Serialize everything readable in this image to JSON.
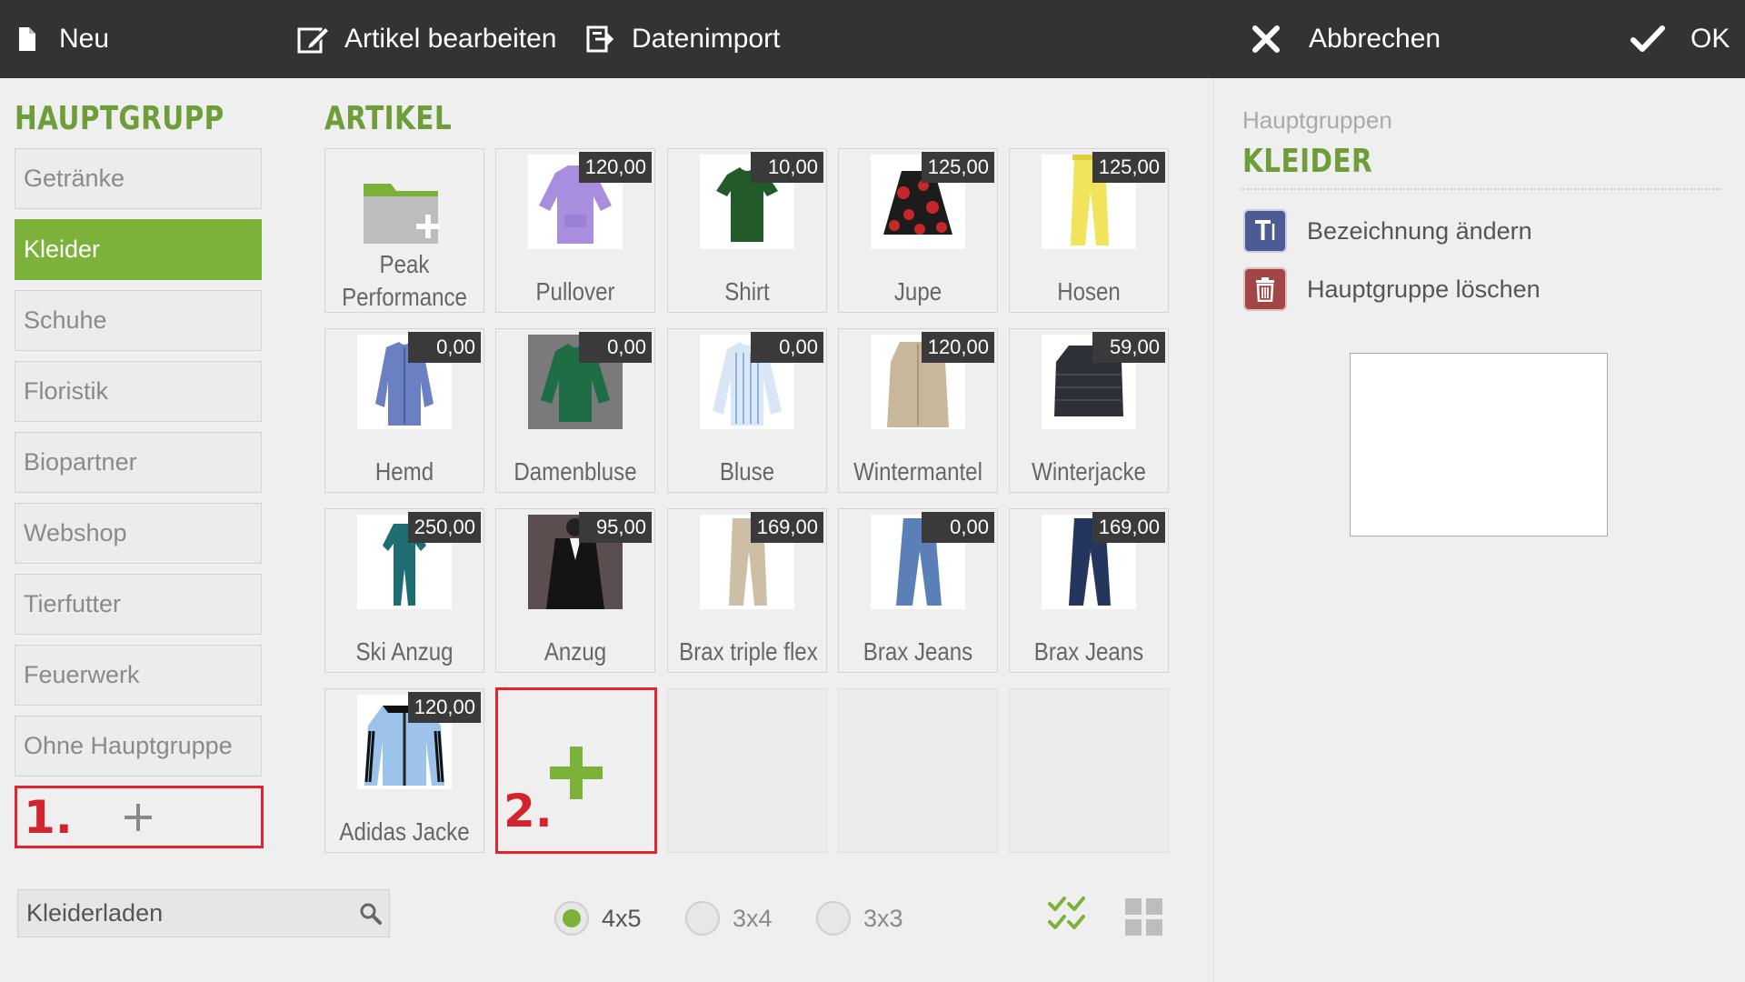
{
  "toolbar": {
    "new_label": "Neu",
    "edit_label": "Artikel bearbeiten",
    "import_label": "Datenimport",
    "cancel_label": "Abbrechen",
    "ok_label": "OK"
  },
  "groups": {
    "title": "HAUPTGRUPP",
    "items": [
      {
        "label": "Getränke"
      },
      {
        "label": "Kleider",
        "active": true
      },
      {
        "label": "Schuhe"
      },
      {
        "label": "Floristik"
      },
      {
        "label": "Biopartner"
      },
      {
        "label": "Webshop"
      },
      {
        "label": "Tierfutter"
      },
      {
        "label": "Feuerwerk"
      },
      {
        "label": "Ohne Hauptgruppe"
      }
    ],
    "add_marker": "1."
  },
  "articles": {
    "title": "ARTIKEL",
    "folder": {
      "line1": "Peak",
      "line2": "Performance"
    },
    "items": [
      {
        "name": "Pullover",
        "price": "120,00",
        "icon": "pullover-image"
      },
      {
        "name": "Shirt",
        "price": "10,00",
        "icon": "shirt-image"
      },
      {
        "name": "Jupe",
        "price": "125,00",
        "icon": "skirt-image"
      },
      {
        "name": "Hosen",
        "price": "125,00",
        "icon": "pants-image"
      },
      {
        "name": "Hemd",
        "price": "0,00",
        "icon": "shirt-button-image"
      },
      {
        "name": "Damenbluse",
        "price": "0,00",
        "icon": "blouse-image"
      },
      {
        "name": "Bluse",
        "price": "0,00",
        "icon": "blouse-striped-image"
      },
      {
        "name": "Wintermantel",
        "price": "120,00",
        "icon": "coat-image"
      },
      {
        "name": "Winterjacke",
        "price": "59,00",
        "icon": "jacket-image"
      },
      {
        "name": "Ski Anzug",
        "price": "250,00",
        "icon": "ski-suit-image"
      },
      {
        "name": "Anzug",
        "price": "95,00",
        "icon": "suit-image"
      },
      {
        "name": "Brax triple flex",
        "price": "169,00",
        "icon": "chinos-image"
      },
      {
        "name": "Brax Jeans",
        "price": "0,00",
        "icon": "jeans-image"
      },
      {
        "name": "Brax Jeans",
        "price": "169,00",
        "icon": "jeans-dark-image"
      },
      {
        "name": "Adidas Jacke",
        "price": "120,00",
        "icon": "track-jacket-image"
      }
    ],
    "add_marker": "2."
  },
  "search": {
    "value": "Kleiderladen"
  },
  "layout_options": {
    "options": [
      {
        "label": "4x5",
        "selected": true
      },
      {
        "label": "3x4",
        "selected": false
      },
      {
        "label": "3x3",
        "selected": false
      }
    ]
  },
  "detail": {
    "subtitle": "Hauptgruppen",
    "title": "KLEIDER",
    "rename_label": "Bezeichnung ändern",
    "delete_label": "Hauptgruppe löschen"
  },
  "colors": {
    "accent": "#7cb13a",
    "toolbar_bg": "#333333",
    "highlight_red": "#e2242e",
    "title_green": "#6e9e3a"
  }
}
